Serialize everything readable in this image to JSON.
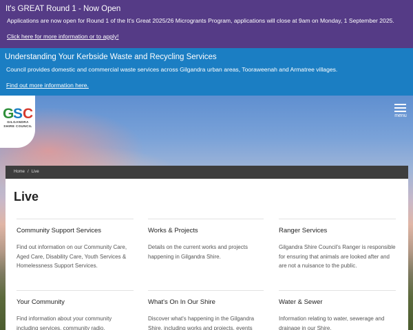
{
  "alerts": [
    {
      "title": "It's GREAT Round 1 - Now Open",
      "text": "Applications are now open for Round 1 of the It's Great 2025/26 Microgrants Program, applications will close at 9am on Monday, 1 September 2025.",
      "link": "Click here for more information or to apply!"
    },
    {
      "title": "Understanding Your Kerbside Waste and Recycling Services",
      "text": "Council provides domestic and commercial waste services across Gilgandra urban areas, Tooraweenah and Armatree villages.",
      "link": "Find out more information here."
    }
  ],
  "logo": {
    "text": "GSC",
    "sub1": "GILGANDRA",
    "sub2": "SHIRE COUNCIL"
  },
  "menu": {
    "label": "menu"
  },
  "breadcrumb": {
    "home": "Home",
    "separator": "/",
    "current": "Live"
  },
  "page": {
    "title": "Live",
    "cards": [
      {
        "title": "Community Support Services",
        "desc": "Find out information on our Community Care, Aged Care, Disability Care, Youth Services & Homelessness Support Services."
      },
      {
        "title": "Works & Projects",
        "desc": "Details on the current works and projects happening in Gilgandra Shire."
      },
      {
        "title": "Ranger Services",
        "desc": "Gilgandra Shire Council's Ranger is responsible for ensuring that animals are looked after and are not a nuisance to the public."
      },
      {
        "title": "Your Community",
        "desc": "Find information about your community including services, community radio,"
      },
      {
        "title": "What's On In Our Shire",
        "desc": "Discover what's happening in the Gilgandra Shire, including works and projects, events"
      },
      {
        "title": "Water & Sewer",
        "desc": "Information relating to water, sewerage and drainage in our Shire."
      }
    ]
  },
  "colors": {
    "alert1_bg": "#553b86",
    "alert2_bg": "#1b7ec3",
    "breadcrumb_bg": "#3d3d3d",
    "logo_g": "#2f8f3a",
    "logo_s": "#1b7ec3",
    "logo_c": "#d63b2f"
  }
}
